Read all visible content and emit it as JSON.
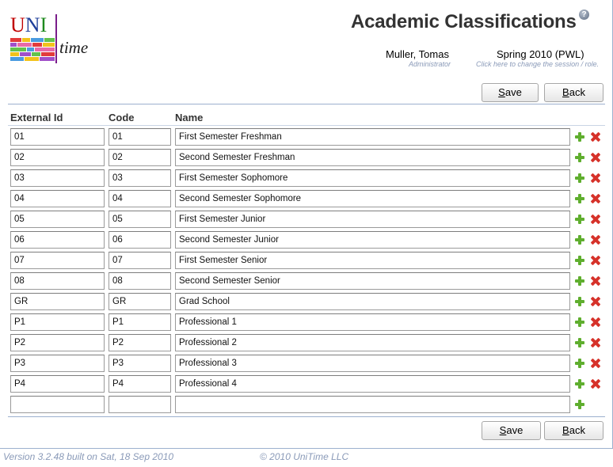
{
  "header": {
    "title": "Academic Classifications",
    "help_icon": "question-circle",
    "user_name": "Muller, Tomas",
    "user_role": "Administrator",
    "session_name": "Spring 2010 (PWL)",
    "session_hint": "Click here to change the session / role."
  },
  "logo": {
    "uni_u": "U",
    "uni_n": "N",
    "uni_i": "I",
    "time": "time"
  },
  "buttons": {
    "save_accel": "S",
    "save_rest": "ave",
    "back_accel": "B",
    "back_rest": "ack"
  },
  "columns": {
    "external_id": "External Id",
    "code": "Code",
    "name": "Name"
  },
  "rows": [
    {
      "external_id": "01",
      "code": "01",
      "name": "First Semester Freshman"
    },
    {
      "external_id": "02",
      "code": "02",
      "name": "Second Semester Freshman"
    },
    {
      "external_id": "03",
      "code": "03",
      "name": "First Semester Sophomore"
    },
    {
      "external_id": "04",
      "code": "04",
      "name": "Second Semester Sophomore"
    },
    {
      "external_id": "05",
      "code": "05",
      "name": "First Semester Junior"
    },
    {
      "external_id": "06",
      "code": "06",
      "name": "Second Semester Junior"
    },
    {
      "external_id": "07",
      "code": "07",
      "name": "First Semester Senior"
    },
    {
      "external_id": "08",
      "code": "08",
      "name": "Second Semester Senior"
    },
    {
      "external_id": "GR",
      "code": "GR",
      "name": "Grad School"
    },
    {
      "external_id": "P1",
      "code": "P1",
      "name": "Professional 1"
    },
    {
      "external_id": "P2",
      "code": "P2",
      "name": "Professional 2"
    },
    {
      "external_id": "P3",
      "code": "P3",
      "name": "Professional 3"
    },
    {
      "external_id": "P4",
      "code": "P4",
      "name": "Professional 4"
    },
    {
      "external_id": "",
      "code": "",
      "name": ""
    }
  ],
  "row_icons": {
    "add": "add-plus-green",
    "delete": "delete-x-red"
  },
  "footer": {
    "version": "Version 3.2.48 built on Sat, 18 Sep 2010",
    "copyright": "© 2010 UniTime LLC"
  },
  "colors": {
    "title": "#333333",
    "hint": "#8a9ab8",
    "border": "#9cb0ce",
    "add_icon": "#5fae2e",
    "delete_icon": "#d6322a"
  }
}
